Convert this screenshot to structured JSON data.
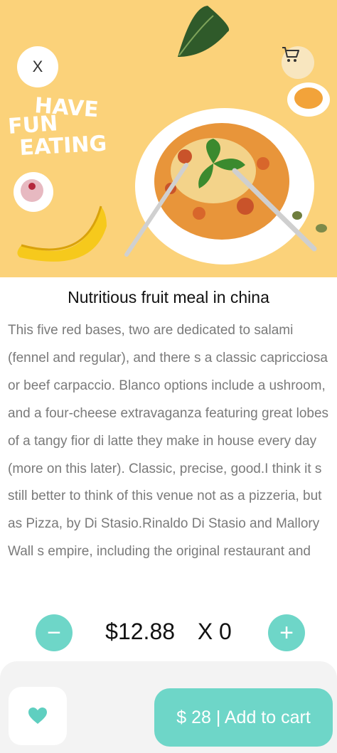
{
  "hero": {
    "slogan_line1": "HAVE",
    "slogan_line2": "FUN",
    "slogan_line3": "EATING",
    "close_label": "X",
    "close_icon": "close-icon",
    "cart_icon": "cart-icon"
  },
  "product": {
    "title": "Nutritious fruit meal in china",
    "description": "This five red bases, two are dedicated to salami (fennel and regular), and there s a classic capricciosa or beef carpaccio. Blanco options include a ushroom, and a four-cheese extravaganza featuring great lobes of a tangy fior di latte they make in house every day (more on this later). Classic, precise, good.I think it s still better to think of this venue not as a pizzeria, but as Pizza, by Di Stasio.Rinaldo Di Stasio and Mallory Wall s empire, including the original restaurant and"
  },
  "quantity": {
    "price": "$12.88",
    "count": "X 0",
    "decrease_label": "−",
    "increase_label": "+"
  },
  "actions": {
    "favorite_icon": "heart-icon",
    "add_to_cart_label": "$ 28 | Add to cart"
  },
  "colors": {
    "hero_background": "#fbd27a",
    "accent": "#6ed6c8",
    "text_muted": "#7a7a7a"
  }
}
